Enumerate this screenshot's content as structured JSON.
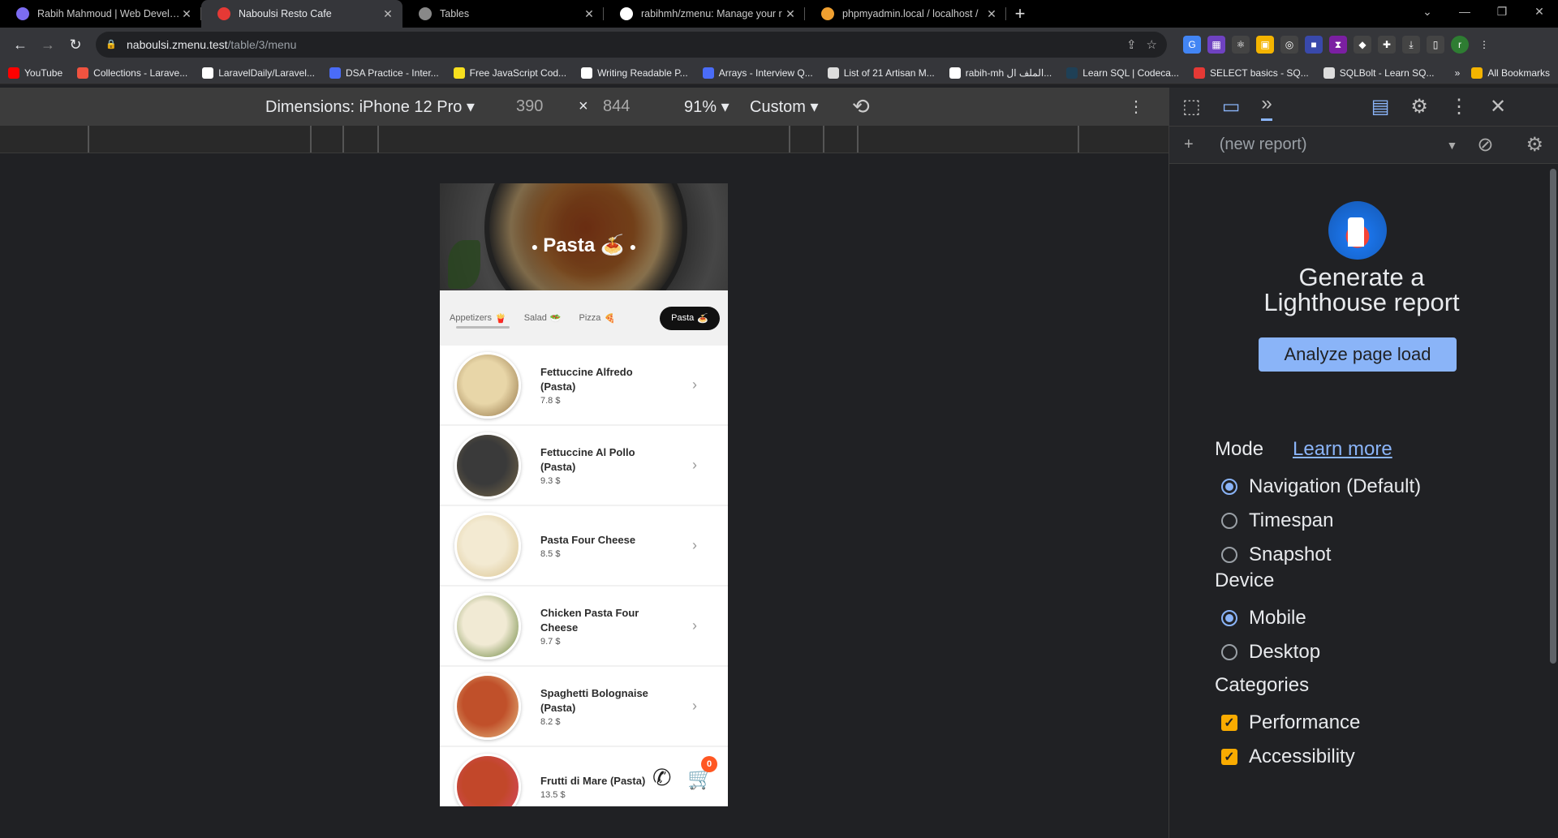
{
  "tabs": [
    {
      "title": "Rabih Mahmoud | Web Develop",
      "icon": "portfolio-icon",
      "color": "#7c6cf2",
      "active": false
    },
    {
      "title": "Naboulsi Resto Cafe",
      "icon": "resto-icon",
      "color": "#e53935",
      "active": true
    },
    {
      "title": "Tables",
      "icon": "globe-icon",
      "color": "#888888",
      "active": false
    },
    {
      "title": "rabihmh/zmenu: Manage your r",
      "icon": "github-icon",
      "color": "#ffffff",
      "active": false
    },
    {
      "title": "phpmyadmin.local / localhost / ",
      "icon": "phpmyadmin-icon",
      "color": "#f0a030",
      "active": false
    }
  ],
  "address": {
    "host": "naboulsi.zmenu.test",
    "path": "/table/3/menu"
  },
  "bookmarks": [
    {
      "label": "YouTube",
      "color": "#ff0000"
    },
    {
      "label": "Collections - Larave...",
      "color": "#f05340"
    },
    {
      "label": "LaravelDaily/Laravel...",
      "color": "#ffffff"
    },
    {
      "label": "DSA Practice - Inter...",
      "color": "#4a6cf7"
    },
    {
      "label": "Free JavaScript Cod...",
      "color": "#f7df1e"
    },
    {
      "label": "Writing Readable P...",
      "color": "#ffffff"
    },
    {
      "label": "Arrays - Interview Q...",
      "color": "#4a6cf7"
    },
    {
      "label": "List of 21 Artisan M...",
      "color": "#dddddd"
    },
    {
      "label": "rabih-mh الملف ال...",
      "color": "#ffffff"
    },
    {
      "label": "Learn SQL | Codeca...",
      "color": "#1f4056"
    },
    {
      "label": "SELECT basics - SQ...",
      "color": "#e53935"
    },
    {
      "label": "SQLBolt - Learn SQ...",
      "color": "#dddddd"
    }
  ],
  "bookmarks_more": "»",
  "all_bookmarks": "All Bookmarks",
  "device_toolbar": {
    "dimensions": "Dimensions: iPhone 12 Pro",
    "width": "390",
    "times": "×",
    "height": "844",
    "zoom": "91%",
    "throttle": "Custom"
  },
  "menu": {
    "hero_title": "Pasta 🍝",
    "categories": [
      {
        "label": "Appetizers",
        "emoji": "🍟",
        "selected": false
      },
      {
        "label": "Salad",
        "emoji": "🥗",
        "selected": false
      },
      {
        "label": "Pizza",
        "emoji": "🍕",
        "selected": false
      },
      {
        "label": "Pasta",
        "emoji": "🍝",
        "selected": true
      }
    ],
    "items": [
      {
        "name": "Fettuccine Alfredo (Pasta)",
        "price": "7.8 $",
        "colors": [
          "#e8d6a8",
          "#8a6a3c"
        ]
      },
      {
        "name": "Fettuccine Al Pollo (Pasta)",
        "price": "9.3 $",
        "colors": [
          "#3a3a3a",
          "#7a6a4a"
        ]
      },
      {
        "name": "Pasta Four Cheese",
        "price": "8.5 $",
        "colors": [
          "#f3ead2",
          "#d7c08a"
        ]
      },
      {
        "name": "Chicken Pasta Four Cheese",
        "price": "9.7 $",
        "colors": [
          "#f1ead4",
          "#5b7a2c"
        ]
      },
      {
        "name": "Spaghetti Bolognaise (Pasta)",
        "price": "8.2 $",
        "colors": [
          "#c0502a",
          "#e9c48a"
        ]
      },
      {
        "name": "Frutti di Mare (Pasta)",
        "price": "13.5 $",
        "colors": [
          "#c2472a",
          "#d94a6a"
        ]
      }
    ],
    "cart_count": "0"
  },
  "devtools": {
    "new_report": "(new report)",
    "heading": "Generate a Lighthouse report",
    "analyze_button": "Analyze page load",
    "mode_label": "Mode",
    "learn_more": "Learn more",
    "modes": [
      {
        "label": "Navigation (Default)",
        "checked": true
      },
      {
        "label": "Timespan",
        "checked": false
      },
      {
        "label": "Snapshot",
        "checked": false
      }
    ],
    "device_label": "Device",
    "devices": [
      {
        "label": "Mobile",
        "checked": true
      },
      {
        "label": "Desktop",
        "checked": false
      }
    ],
    "categories_label": "Categories",
    "categories": [
      {
        "label": "Performance",
        "checked": true
      },
      {
        "label": "Accessibility",
        "checked": true
      }
    ]
  }
}
